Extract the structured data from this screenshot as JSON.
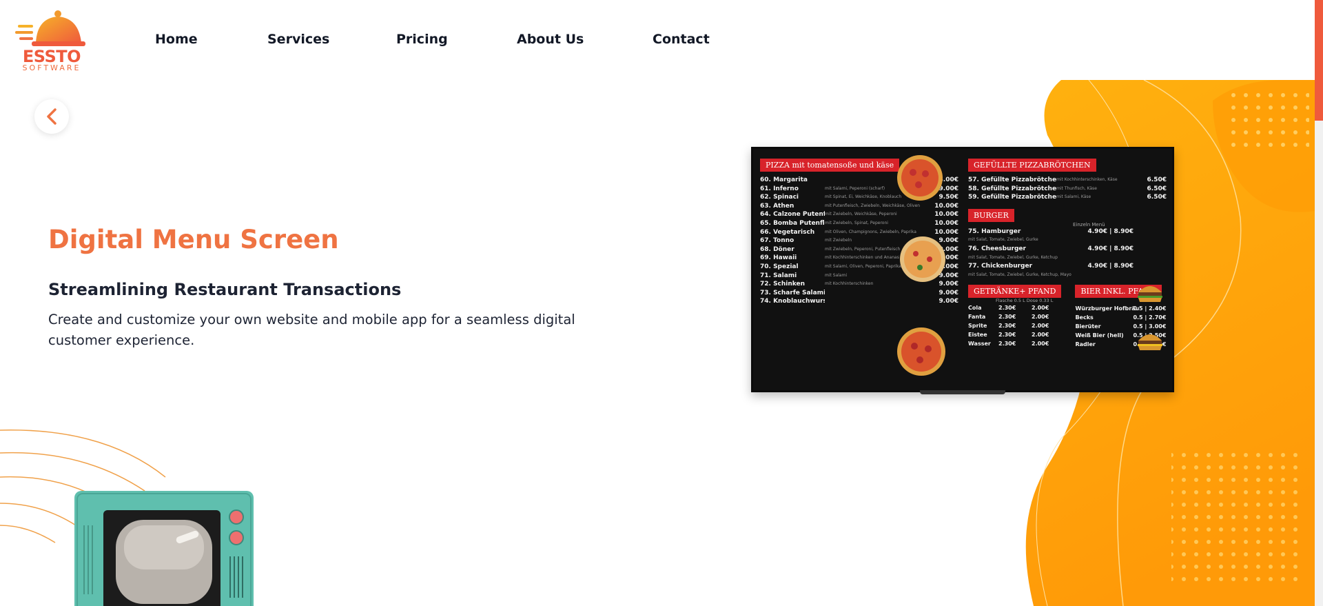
{
  "logo": {
    "word": "ESSTO",
    "sub": "SOFTWARE"
  },
  "nav": {
    "items": [
      {
        "label": "Home"
      },
      {
        "label": "Services"
      },
      {
        "label": "Pricing"
      },
      {
        "label": "About Us"
      },
      {
        "label": "Contact"
      }
    ]
  },
  "hero": {
    "title": "Digital Menu Screen",
    "subtitle": "Streamlining Restaurant Transactions",
    "description": "Create and customize your own website and mobile app for a seamless digital customer experience."
  },
  "menu_screen": {
    "pizza_heading": "PIZZA mit tomatensoße und käse",
    "pizza_items": [
      {
        "name": "60. Margarita",
        "desc": "",
        "price": "8.00€"
      },
      {
        "name": "61. Inferno",
        "desc": "mit Salami, Peperoni (scharf)",
        "price": "9.00€"
      },
      {
        "name": "62. Spinaci",
        "desc": "mit Spinat, Ei, Weichkäse, Knoblauch",
        "price": "9.50€"
      },
      {
        "name": "63. Athen",
        "desc": "mit Putenfleisch, Zwiebeln, Weichkäse, Oliven",
        "price": "10.00€"
      },
      {
        "name": "64. Calzone Putenfleisch",
        "desc": "mit Zwiebeln, Weichkäse, Peperoni",
        "price": "10.00€"
      },
      {
        "name": "65. Bomba Putenfleisch",
        "desc": "mit Zwiebeln, Spinat, Peperoni",
        "price": "10.00€"
      },
      {
        "name": "66. Vegetarisch",
        "desc": "mit Oliven, Champignons, Zwiebeln, Paprika",
        "price": "10.00€"
      },
      {
        "name": "67. Tonno",
        "desc": "mit Zwiebeln",
        "price": "9.00€"
      },
      {
        "name": "68. Döner",
        "desc": "mit Zwiebeln, Peperoni, Putenfleisch",
        "price": "10.00€"
      },
      {
        "name": "69. Hawaii",
        "desc": "mit Kochhinterschinken und Ananas",
        "price": "9.00€"
      },
      {
        "name": "70. Spezial",
        "desc": "mit Salami, Oliven, Peperoni, Paprika, Pilze",
        "price": "10.00€"
      },
      {
        "name": "71. Salami",
        "desc": "mit Salami",
        "price": "9.00€"
      },
      {
        "name": "72. Schinken",
        "desc": "mit Kochhinterschinken",
        "price": "9.00€"
      },
      {
        "name": "73. Scharfe Salami",
        "desc": "",
        "price": "9.00€"
      },
      {
        "name": "74. Knoblauchwurst",
        "desc": "",
        "price": "9.00€"
      }
    ],
    "rolls_heading": "GEFÜLLTE PIZZABRÖTCHEN",
    "rolls_items": [
      {
        "name": "57. Gefüllte Pizzabrötchen",
        "desc": "mit Kochhinterschinken, Käse",
        "price": "6.50€"
      },
      {
        "name": "58. Gefüllte Pizzabrötchen",
        "desc": "mit Thunfisch, Käse",
        "price": "6.50€"
      },
      {
        "name": "59. Gefüllte Pizzabrötchen",
        "desc": "mit Salami, Käse",
        "price": "6.50€"
      }
    ],
    "burger_heading": "BURGER",
    "burger_cols": "Einzeln   Menü",
    "burger_items": [
      {
        "name": "75. Hamburger",
        "desc": "mit Salat, Tomate, Zwiebel, Gurke",
        "price": "4.90€ | 8.90€"
      },
      {
        "name": "76. Cheesburger",
        "desc": "mit Salat, Tomate, Zwiebel, Gurke, Ketchup",
        "price": "4.90€ | 8.90€"
      },
      {
        "name": "77. Chickenburger",
        "desc": "mit Salat, Tomate, Zwiebel, Gurke, Ketchup, Mayo",
        "price": "4.90€ | 8.90€"
      }
    ],
    "drinks_heading": "GETRÄNKE+ PFAND",
    "drinks_cols": "Flasche 0.5 L   Dose 0.33 L",
    "drinks": [
      {
        "name": "Cola",
        "a": "2.30€",
        "b": "2.00€"
      },
      {
        "name": "Fanta",
        "a": "2.30€",
        "b": "2.00€"
      },
      {
        "name": "Sprite",
        "a": "2.30€",
        "b": "2.00€"
      },
      {
        "name": "Eistee",
        "a": "2.30€",
        "b": "2.00€"
      },
      {
        "name": "Wasser",
        "a": "2.30€",
        "b": "2.00€"
      }
    ],
    "beer_heading": "BIER INKL. PFAND",
    "beers": [
      {
        "name": "Würzburger Hofbräu",
        "price": "0.5 | 2.40€"
      },
      {
        "name": "Becks",
        "price": "0.5 | 2.70€"
      },
      {
        "name": "Bierüter",
        "price": "0.5 | 3.00€"
      },
      {
        "name": "Weiß Bier (hell)",
        "price": "0.5 | 2.50€"
      },
      {
        "name": "Radler",
        "price": "0.4 | 2.80€"
      }
    ]
  },
  "colors": {
    "accent": "#ef7342",
    "brand": "#ef5a3c",
    "blob": "#ffa20a",
    "menu_red": "#d8232a"
  }
}
